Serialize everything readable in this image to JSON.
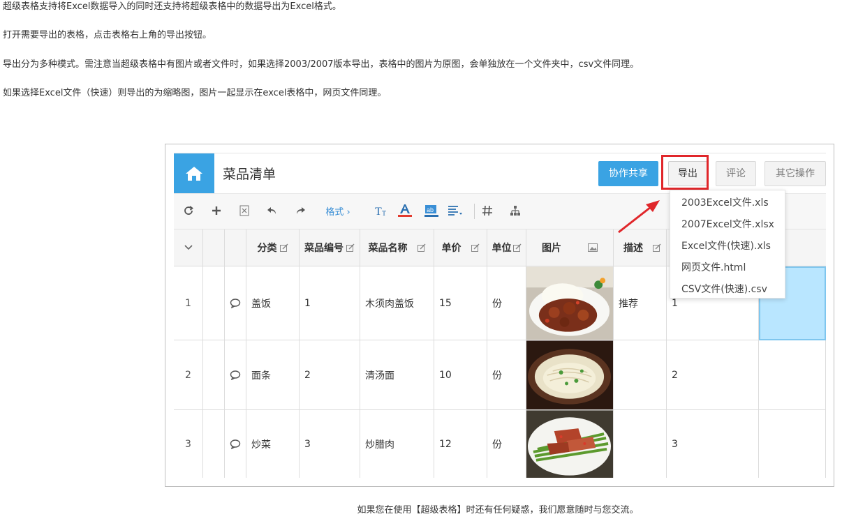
{
  "paragraphs": {
    "p1": "超级表格支持将Excel数据导入的同时还支持将超级表格中的数据导出为Excel格式。",
    "p2": "打开需要导出的表格，点击表格右上角的导出按钮。",
    "p3": "导出分为多种模式。需注意当超级表格中有图片或者文件时，如果选择2003/2007版本导出，表格中的图片为原图，会单独放在一个文件夹中，csv文件同理。",
    "p4": "如果选择Excel文件（快速）则导出的为缩略图，图片一起显示在excel表格中，网页文件同理。"
  },
  "app": {
    "title": "菜品清单",
    "buttons": {
      "share": "协作共享",
      "export": "导出",
      "comment": "评论",
      "more": "其它操作"
    },
    "toolbar": {
      "format": "格式 ›"
    },
    "export_menu": [
      "2003Excel文件.xls",
      "2007Excel文件.xlsx",
      "Excel文件(快速).xls",
      "网页文件.html",
      "CSV文件(快速).csv"
    ],
    "columns": {
      "category": "分类",
      "code": "菜品编号",
      "name": "菜品名称",
      "price": "单价",
      "unit": "单位",
      "image": "图片",
      "desc": "描述"
    },
    "rows": [
      {
        "index": "1",
        "category": "盖饭",
        "code": "1",
        "name": "木须肉盖饭",
        "price": "15",
        "unit": "份",
        "desc": "推荐",
        "extra": "1"
      },
      {
        "index": "2",
        "category": "面条",
        "code": "2",
        "name": "清汤面",
        "price": "10",
        "unit": "份",
        "desc": "",
        "extra": "2"
      },
      {
        "index": "3",
        "category": "炒菜",
        "code": "3",
        "name": "炒腊肉",
        "price": "12",
        "unit": "份",
        "desc": "",
        "extra": "3"
      }
    ]
  },
  "colors": {
    "accent_blue": "#3aa3e3",
    "highlight_red": "#e0262a",
    "selected_cell": "#b9e6ff"
  },
  "icons": [
    "home-icon",
    "refresh-icon",
    "plus-icon",
    "excel-icon",
    "undo-icon",
    "redo-icon",
    "font-size-icon",
    "font-color-icon",
    "bg-color-icon",
    "align-icon",
    "hash-icon",
    "tree-icon",
    "chevron-down-icon",
    "edit-icon",
    "comment-icon",
    "image-icon",
    "arrow-icon"
  ],
  "footer": "如果您在使用【超级表格】时还有任何疑惑，我们愿意随时与您交流。"
}
